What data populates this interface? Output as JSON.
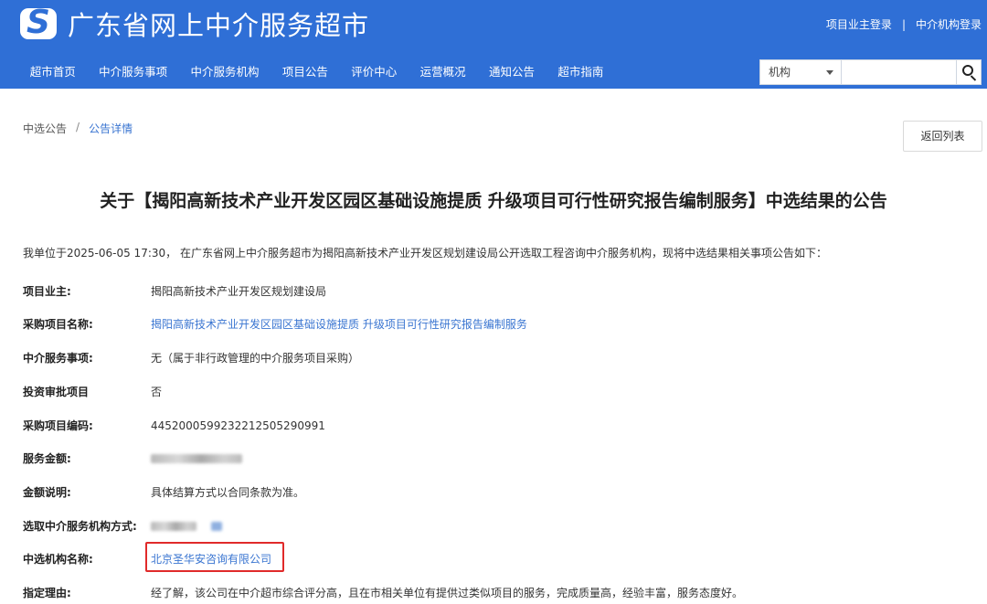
{
  "header": {
    "site_title": "广东省网上中介服务超市",
    "logo_letter": "S",
    "links": {
      "owner_login": "项目业主登录",
      "separator": "|",
      "agency_login": "中介机构登录"
    },
    "nav": [
      {
        "label": "超市首页"
      },
      {
        "label": "中介服务事项"
      },
      {
        "label": "中介服务机构"
      },
      {
        "label": "项目公告"
      },
      {
        "label": "评价中心"
      },
      {
        "label": "运营概况"
      },
      {
        "label": "通知公告"
      },
      {
        "label": "超市指南"
      }
    ],
    "search": {
      "select_value": "机构",
      "input_value": ""
    },
    "accent_color": "#2f6fd6"
  },
  "breadcrumb": {
    "root": "中选公告",
    "separator": "/",
    "current": "公告详情"
  },
  "back_button": "返回列表",
  "notice": {
    "title": "关于【揭阳高新技术产业开发区园区基础设施提质 升级项目可行性研究报告编制服务】中选结果的公告",
    "intro": "我单位于2025-06-05 17:30， 在广东省网上中介服务超市为揭阳高新技术产业开发区规划建设局公开选取工程咨询中介服务机构，现将中选结果相关事项公告如下：",
    "fields": {
      "owner": {
        "label": "项目业主:",
        "value": "揭阳高新技术产业开发区规划建设局"
      },
      "project_name": {
        "label": "采购项目名称:",
        "value": "揭阳高新技术产业开发区园区基础设施提质 升级项目可行性研究报告编制服务"
      },
      "service_item": {
        "label": "中介服务事项:",
        "value": "无（属于非行政管理的中介服务项目采购）"
      },
      "investment_approval": {
        "label": "投资审批项目",
        "value": "否"
      },
      "project_code": {
        "label": "采购项目编码:",
        "value": "44520005992322125052909​91"
      },
      "service_amount": {
        "label": "服务金额:"
      },
      "amount_note": {
        "label": "金额说明:",
        "value": "具体结算方式以合同条款为准。"
      },
      "selection_method": {
        "label": "选取中介服务机构方式:"
      },
      "winner": {
        "label": "中选机构名称:",
        "value": "北京圣华安咨询有限公司"
      },
      "reason": {
        "label": "指定理由:",
        "value": "经了解，该公司在中介超市综合评分高，且在市相关单位有提供过类似项目的服务，完成质量高，经验丰富，服务态度好。"
      }
    }
  },
  "highlight_color": "#e02a2a"
}
